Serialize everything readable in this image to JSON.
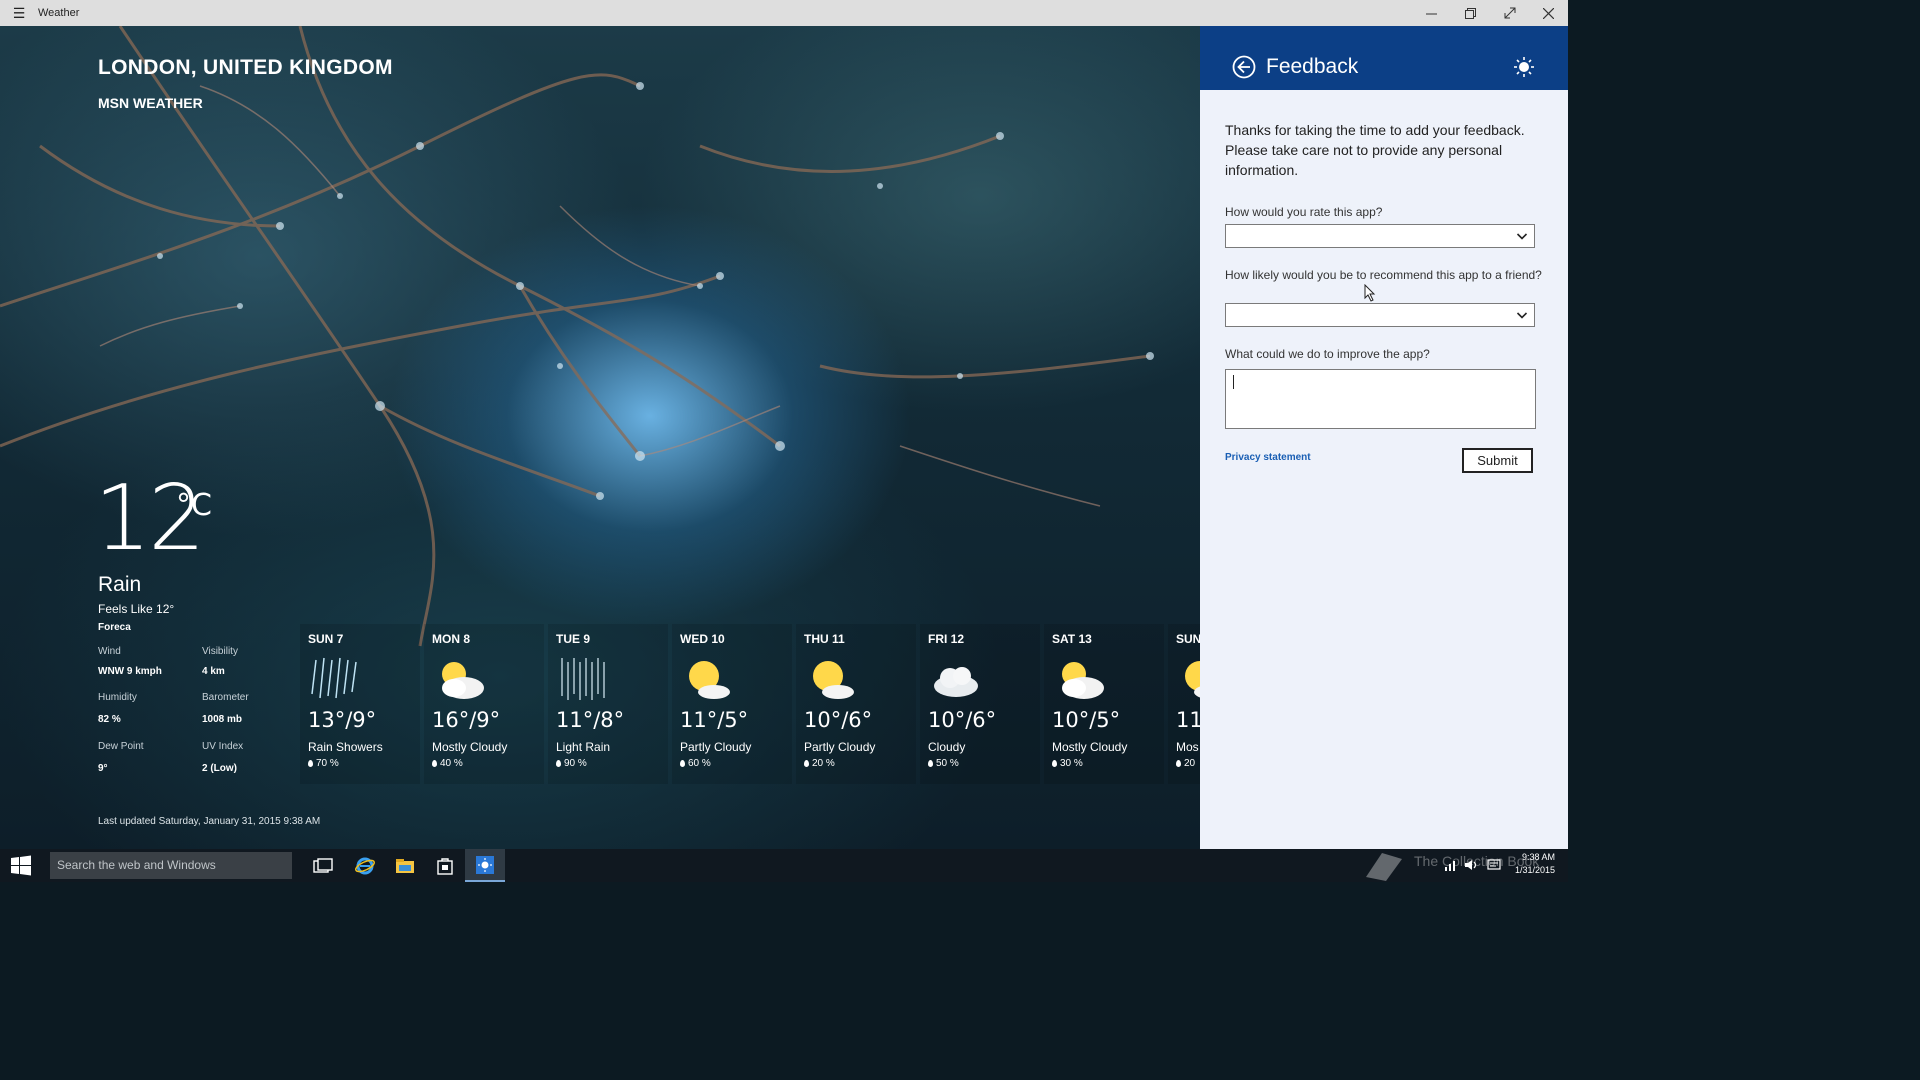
{
  "window": {
    "title": "Weather"
  },
  "location": {
    "title": "LONDON, UNITED KINGDOM",
    "subtitle": "MSN WEATHER"
  },
  "current": {
    "temp": "12",
    "unit": "°C",
    "condition": "Rain",
    "feels_like": "Feels Like 12°",
    "provider": "Foreca",
    "details": [
      {
        "label": "Wind",
        "value": "WNW 9 kmph"
      },
      {
        "label": "Visibility",
        "value": "4 km"
      },
      {
        "label": "Humidity",
        "value": "82 %"
      },
      {
        "label": "Barometer",
        "value": "1008 mb"
      },
      {
        "label": "Dew Point",
        "value": "9°"
      },
      {
        "label": "UV Index",
        "value": "2 (Low)"
      }
    ],
    "last_updated": "Last updated Saturday, January 31, 2015 9:38 AM"
  },
  "forecast": [
    {
      "day": "SUN 7",
      "temp": "13°/9°",
      "condition": "Rain Showers",
      "precip": "70 %",
      "icon": "rain-showers-icon"
    },
    {
      "day": "MON 8",
      "temp": "16°/9°",
      "condition": "Mostly Cloudy",
      "precip": "40 %",
      "icon": "mostly-cloudy-icon"
    },
    {
      "day": "TUE 9",
      "temp": "11°/8°",
      "condition": "Light Rain",
      "precip": "90 %",
      "icon": "light-rain-icon"
    },
    {
      "day": "WED 10",
      "temp": "11°/5°",
      "condition": "Partly Cloudy",
      "precip": "60 %",
      "icon": "partly-cloudy-icon"
    },
    {
      "day": "THU 11",
      "temp": "10°/6°",
      "condition": "Partly Cloudy",
      "precip": "20 %",
      "icon": "partly-cloudy-icon"
    },
    {
      "day": "FRI 12",
      "temp": "10°/6°",
      "condition": "Cloudy",
      "precip": "50 %",
      "icon": "cloudy-icon"
    },
    {
      "day": "SAT 13",
      "temp": "10°/5°",
      "condition": "Mostly Cloudy",
      "precip": "30 %",
      "icon": "mostly-cloudy-icon"
    },
    {
      "day": "SUN",
      "temp": "11",
      "condition": "Mos",
      "precip": "20",
      "icon": "partly-cloudy-icon"
    }
  ],
  "feedback": {
    "title": "Feedback",
    "intro": "Thanks for taking the time to add your feedback. Please take care not to provide any personal information.",
    "q1": "How would you rate this app?",
    "q2": "How likely would you be to recommend this app to a friend?",
    "q3": "What could we do to improve the app?",
    "improve_value": "",
    "privacy": "Privacy statement",
    "submit": "Submit"
  },
  "taskbar": {
    "search_placeholder": "Search the web and Windows",
    "watermark": "The Collection Book",
    "time": "9:38 AM",
    "date": "1/31/2015"
  },
  "colors": {
    "panel_header": "#0c3f86",
    "panel_bg": "#eef2fa",
    "link": "#1a5fb4",
    "taskbar": "#101820"
  }
}
